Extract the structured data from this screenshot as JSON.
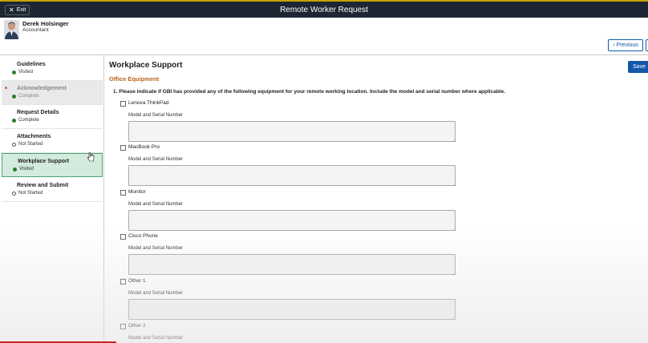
{
  "header": {
    "exit_label": "Exit",
    "app_title": "Remote Worker Request"
  },
  "user": {
    "name": "Derek Holsinger",
    "role": "Accountant"
  },
  "nav": {
    "previous_label": "Previous"
  },
  "steps": [
    {
      "label": "Guidelines",
      "status": "Visited"
    },
    {
      "label": "Acknowledgement",
      "status": "Complete"
    },
    {
      "label": "Request Details",
      "status": "Complete"
    },
    {
      "label": "Attachments",
      "status": "Not Started"
    },
    {
      "label": "Workplace Support",
      "status": "Visited"
    },
    {
      "label": "Review and Submit",
      "status": "Not Started"
    }
  ],
  "main": {
    "save_label": "Save",
    "title": "Workplace Support",
    "section": "Office Equipment",
    "question": "1. Please indicate if GBI has provided any of the following equipment for your remote working location. Include the model and serial number where applicable.",
    "field_label": "Model and Serial Number",
    "items": [
      {
        "label": "Lenova ThinkPad",
        "value": ""
      },
      {
        "label": "MacBook Pro",
        "value": ""
      },
      {
        "label": "Monitor",
        "value": ""
      },
      {
        "label": "Cisco Phone",
        "value": ""
      },
      {
        "label": "Other 1",
        "value": ""
      },
      {
        "label": "Other 2",
        "value": ""
      }
    ]
  },
  "colors": {
    "topbar": "#1d2733",
    "accent": "#1257a8",
    "section_title": "#b8621b",
    "active_step_bg": "#d2ebdd",
    "status_dot": "#2f7a2f"
  }
}
